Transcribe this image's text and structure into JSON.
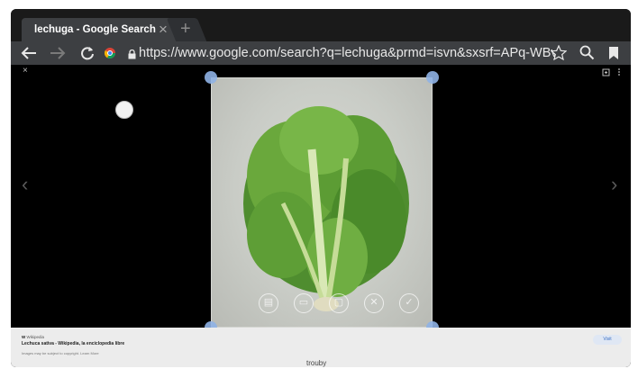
{
  "tab": {
    "title": "lechuga - Google Search",
    "close": "×"
  },
  "toolbar": {
    "url": "https://www.google.com/search?q=lechuga&prmd=isvn&sxsrf=APq-WBvDjJgkl"
  },
  "viewer": {
    "close": "×",
    "prev": "‹",
    "next": "›"
  },
  "panel": {
    "source": "Wikipedia",
    "title": "Lechuca sativa - Wikipedia, la enciclopedia libre",
    "copyright": "Images may be subject to copyright. Learn More",
    "visit": "Visit"
  },
  "bottom": {
    "text": "trouby"
  }
}
